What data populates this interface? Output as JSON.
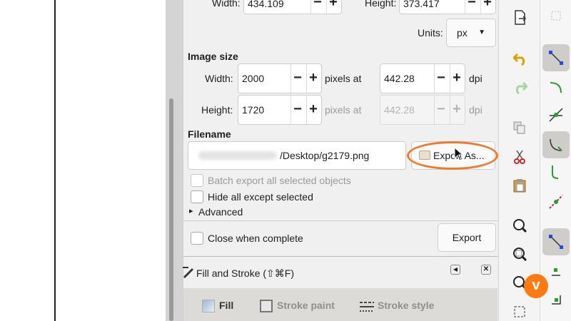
{
  "document_size": {
    "width_label": "Width:",
    "width_value": "434.109",
    "height_label": "Height:",
    "height_value": "373.417",
    "units_label": "Units:",
    "units_value": "px"
  },
  "image_size": {
    "title": "Image size",
    "width_label": "Width:",
    "width_value": "2000",
    "height_label": "Height:",
    "height_value": "1720",
    "pixels_at": "pixels at",
    "dpi_value": "442.28",
    "dpi_value_disabled": "442.28",
    "dpi_label": "dpi"
  },
  "filename": {
    "title": "Filename",
    "path_visible": "/Desktop/g2179.png",
    "export_as_label": "Export As..."
  },
  "options": {
    "batch_export": "Batch export all selected objects",
    "hide_all_except": "Hide all except selected",
    "advanced": "Advanced",
    "close_when_complete": "Close when complete",
    "export_button": "Export"
  },
  "fill_stroke": {
    "title": "Fill and Stroke (⇧⌘F)",
    "tabs": [
      "Fill",
      "Stroke paint",
      "Stroke style"
    ]
  },
  "glyphs": {
    "plus": "+",
    "minus": "−",
    "caret": "▸",
    "vimeo": "v"
  },
  "icons": [
    "export-icon",
    "undo-icon",
    "redo-icon",
    "copy-icon",
    "cut-icon",
    "paste-icon",
    "zoom-icon",
    "zoom-drawing-icon",
    "zoom-page-icon",
    "snap-icons"
  ],
  "colors": {
    "highlight": "#f07a2a",
    "panel_bg": "#f0f0f0",
    "vimeo": "#ff7a10"
  }
}
